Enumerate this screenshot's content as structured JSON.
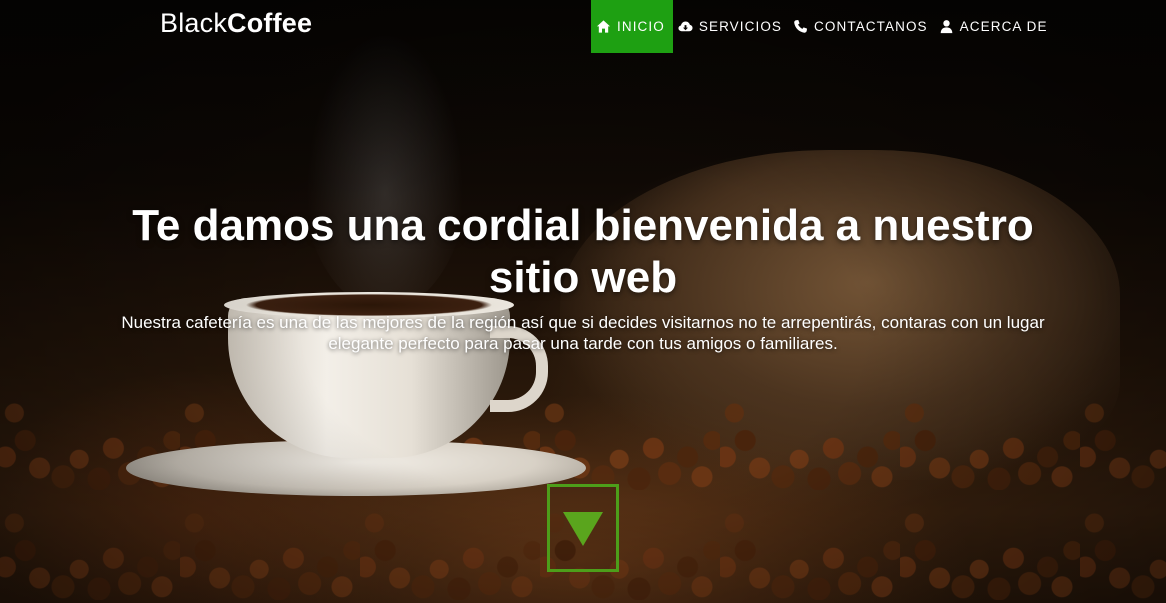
{
  "navbar": {
    "brand": {
      "part1": "Black",
      "part2": "Coffee"
    },
    "items": [
      {
        "label": "Inicio",
        "icon": "home-icon",
        "active": true
      },
      {
        "label": "Servicios",
        "icon": "cloud-download-icon",
        "active": false
      },
      {
        "label": "Contactanos",
        "icon": "phone-icon",
        "active": false
      },
      {
        "label": "Acerca de",
        "icon": "user-icon",
        "active": false
      }
    ]
  },
  "hero": {
    "title": "Te damos una cordial bienvenida a nuestro sitio web",
    "text": "Nuestra cafetería es una de las mejores de la región así que si decides visitarnos no te arrepentirás, contaras con un lugar elegante perfecto para pasar una tarde con tus amigos o familiares.",
    "scroll_icon": "triangle-down-icon"
  },
  "colors": {
    "accent_green": "#1ea012",
    "scroll_border": "#4d9e1a",
    "scroll_arrow": "#5aa51d",
    "text": "#ffffff"
  }
}
